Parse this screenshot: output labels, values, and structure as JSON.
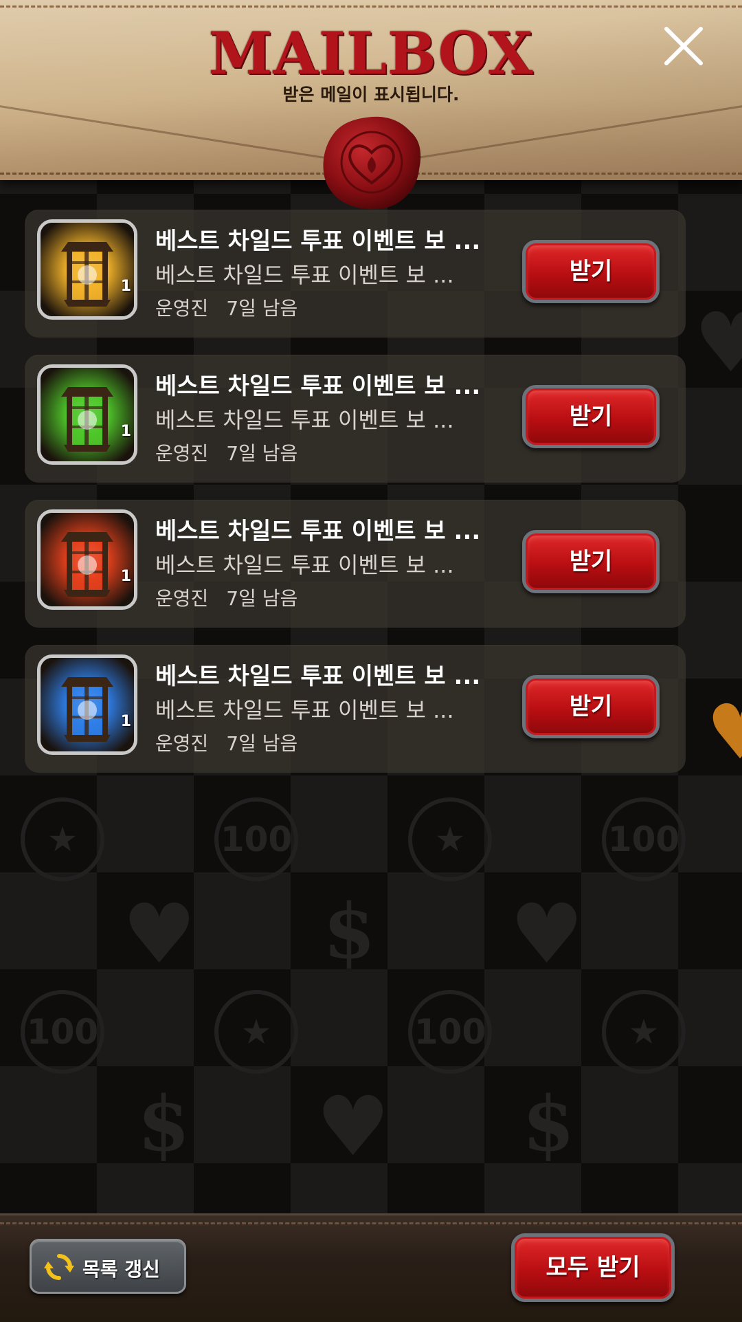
{
  "header": {
    "title": "MAILBOX",
    "subtitle": "받은 메일이 표시됩니다."
  },
  "mails": [
    {
      "title": "베스트 차일드 투표 이벤트 보  ...",
      "body": "베스트 차일드 투표 이벤트 보  ...",
      "sender": "운영진",
      "remaining": "7일 남음",
      "quantity": "1",
      "item_color": "gold",
      "button": "받기"
    },
    {
      "title": "베스트 차일드 투표 이벤트 보  ...",
      "body": "베스트 차일드 투표 이벤트 보  ...",
      "sender": "운영진",
      "remaining": "7일 남음",
      "quantity": "1",
      "item_color": "green",
      "button": "받기"
    },
    {
      "title": "베스트 차일드 투표 이벤트 보  ...",
      "body": "베스트 차일드 투표 이벤트 보  ...",
      "sender": "운영진",
      "remaining": "7일 남음",
      "quantity": "1",
      "item_color": "red",
      "button": "받기"
    },
    {
      "title": "베스트 차일드 투표 이벤트 보  ...",
      "body": "베스트 차일드 투표 이벤트 보  ...",
      "sender": "운영진",
      "remaining": "7일 남음",
      "quantity": "1",
      "item_color": "blue",
      "button": "받기"
    }
  ],
  "footer": {
    "refresh_label": "목록 갱신",
    "receive_all_label": "모두 받기"
  },
  "background_glyphs": {
    "coin_label": "100",
    "star": "★",
    "heart": "♥",
    "dollar": "$"
  },
  "colors": {
    "accent_red": "#b90e12",
    "header_parchment": "#d2b893",
    "gold": "#f2b32a",
    "green": "#4fc72a",
    "red": "#e5411d",
    "blue": "#2f7fe8"
  }
}
